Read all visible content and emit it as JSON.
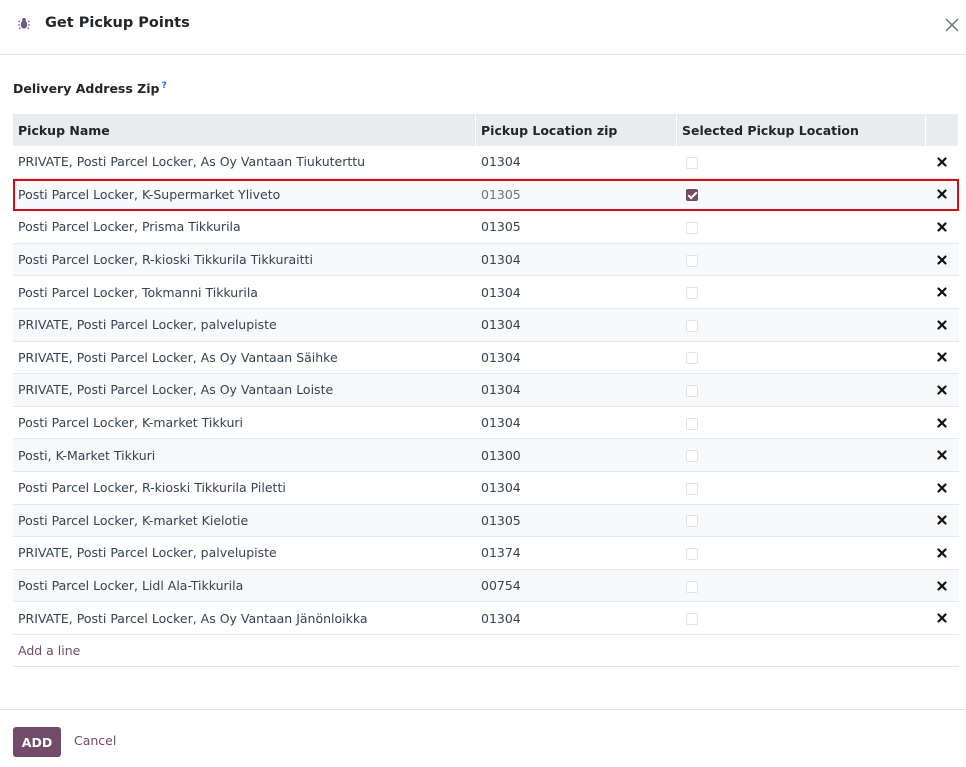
{
  "dialog": {
    "title": "Get Pickup Points",
    "icon": "bug-icon",
    "close_icon": "close-icon"
  },
  "field": {
    "label": "Delivery Address Zip",
    "help_marker": "?"
  },
  "table": {
    "columns": [
      "Pickup Name",
      "Pickup Location zip",
      "Selected Pickup Location",
      ""
    ],
    "rows": [
      {
        "name": "PRIVATE, Posti Parcel Locker, As Oy Vantaan Tiukuterttu",
        "zip": "01304",
        "selected": false
      },
      {
        "name": "Posti Parcel Locker, K-Supermarket Yliveto",
        "zip": "01305",
        "selected": true
      },
      {
        "name": "Posti Parcel Locker, Prisma Tikkurila",
        "zip": "01305",
        "selected": false
      },
      {
        "name": "Posti Parcel Locker, R-kioski Tikkurila Tikkuraitti",
        "zip": "01304",
        "selected": false
      },
      {
        "name": "Posti Parcel Locker, Tokmanni Tikkurila",
        "zip": "01304",
        "selected": false
      },
      {
        "name": "PRIVATE, Posti Parcel Locker, palvelupiste",
        "zip": "01304",
        "selected": false
      },
      {
        "name": "PRIVATE, Posti Parcel Locker, As Oy Vantaan Säihke",
        "zip": "01304",
        "selected": false
      },
      {
        "name": "PRIVATE, Posti Parcel Locker, As Oy Vantaan Loiste",
        "zip": "01304",
        "selected": false
      },
      {
        "name": "Posti Parcel Locker, K-market Tikkuri",
        "zip": "01304",
        "selected": false
      },
      {
        "name": "Posti, K-Market Tikkuri",
        "zip": "01300",
        "selected": false
      },
      {
        "name": "Posti Parcel Locker, R-kioski Tikkurila Piletti",
        "zip": "01304",
        "selected": false
      },
      {
        "name": "Posti Parcel Locker, K-market Kielotie",
        "zip": "01305",
        "selected": false
      },
      {
        "name": "PRIVATE, Posti Parcel Locker, palvelupiste",
        "zip": "01374",
        "selected": false
      },
      {
        "name": "Posti Parcel Locker, Lidl Ala-Tikkurila",
        "zip": "00754",
        "selected": false
      },
      {
        "name": "PRIVATE, Posti Parcel Locker, As Oy Vantaan Jänönloikka",
        "zip": "01304",
        "selected": false
      }
    ],
    "add_line_label": "Add a line",
    "delete_icon": "delete-x-icon"
  },
  "footer": {
    "add_label": "ADD",
    "cancel_label": "Cancel"
  },
  "colors": {
    "primary": "#714b67",
    "highlight_outline": "#d00d1b",
    "header_bg": "#e9ecef"
  }
}
